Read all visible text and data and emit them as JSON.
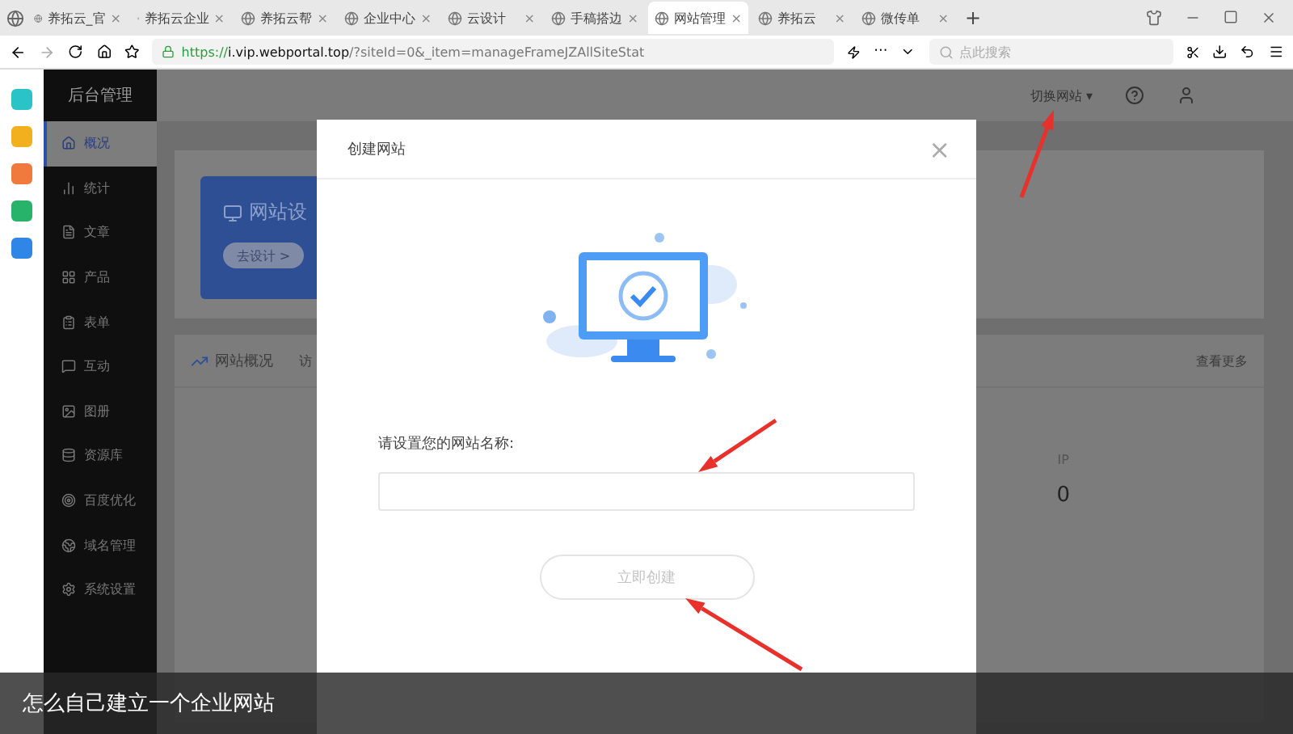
{
  "browser": {
    "tabs": [
      {
        "label": "养拓云_官",
        "close": "×",
        "selected": false
      },
      {
        "label": "养拓云企业",
        "close": "×",
        "selected": false
      },
      {
        "label": "养拓云帮",
        "close": "×",
        "selected": false
      },
      {
        "label": "企业中心",
        "close": "×",
        "selected": false
      },
      {
        "label": "云设计",
        "close": "×",
        "selected": false
      },
      {
        "label": "手稿搭边",
        "close": "×",
        "selected": false
      },
      {
        "label": "网站管理",
        "close": "×",
        "selected": true
      },
      {
        "label": "养拓云",
        "close": "×",
        "selected": false
      },
      {
        "label": "微传单",
        "close": "×",
        "selected": false
      }
    ],
    "new_tab": "+",
    "url": {
      "scheme": "https://",
      "host": "i.vip.webportal.top",
      "path": "/?siteId=0&_item=manageFrameJZAllSiteStat"
    },
    "more": "···",
    "search": {
      "placeholder": "点此搜索"
    }
  },
  "app": {
    "title": "后台管理",
    "sidebar": [
      {
        "label": "概况",
        "selected": true
      },
      {
        "label": "统计",
        "selected": false
      },
      {
        "label": "文章",
        "selected": false
      },
      {
        "label": "产品",
        "selected": false
      },
      {
        "label": "表单",
        "selected": false
      },
      {
        "label": "互动",
        "selected": false
      },
      {
        "label": "图册",
        "selected": false
      },
      {
        "label": "资源库",
        "selected": false
      },
      {
        "label": "百度优化",
        "selected": false
      },
      {
        "label": "域名管理",
        "selected": false
      },
      {
        "label": "系统设置",
        "selected": false
      }
    ],
    "header": {
      "switch_site": "切换网站",
      "caret": "▾"
    },
    "banner": {
      "title": "网站设",
      "button": "去设计 >"
    },
    "overview": {
      "title": "网站概况",
      "tab": "访",
      "more": "查看更多",
      "stat_label": "IP",
      "stat_value": "0"
    }
  },
  "dialog": {
    "title": "创建网站",
    "close": "×",
    "field_label": "请设置您的网站名称:",
    "button": {
      "label": "立即创建",
      "disabled": true
    }
  },
  "caption": "怎么自己建立一个企业网站"
}
